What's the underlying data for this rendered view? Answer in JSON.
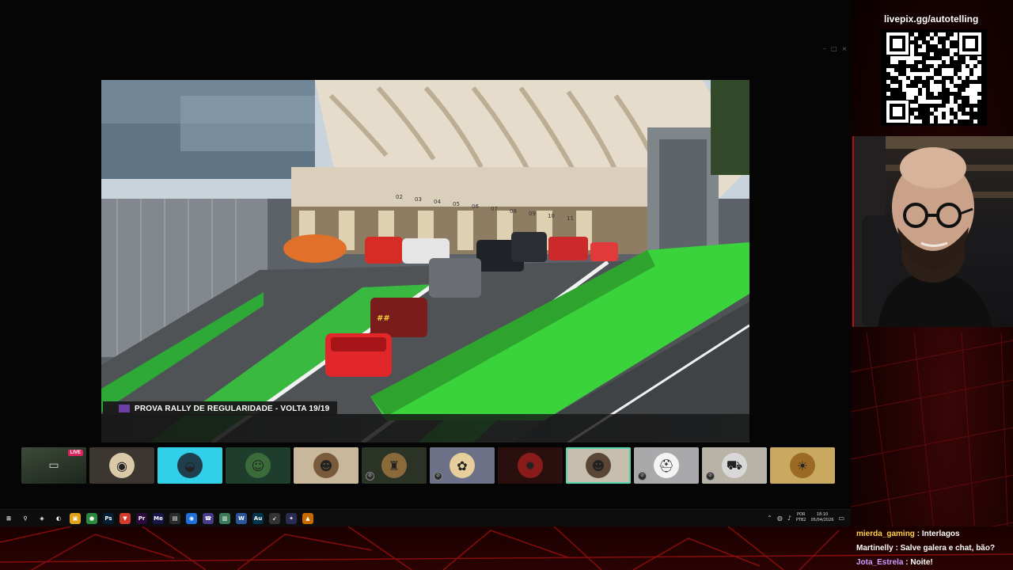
{
  "video": {
    "overlay_title": "PROVA RALLY DE REGULARIDADE  -  VOLTA 19/19",
    "pit_numbers": [
      "02",
      "03",
      "04",
      "05",
      "06",
      "07",
      "08",
      "09",
      "10",
      "11"
    ],
    "car_plate": "##"
  },
  "participants": [
    {
      "kind": "live",
      "badge": "LIVE",
      "bg": "#2a3a2a",
      "muted": false
    },
    {
      "kind": "avatar",
      "glyph": "◉",
      "bg": "#3b3631",
      "avatar": "#d9c9a8",
      "muted": false
    },
    {
      "kind": "avatar",
      "glyph": "◒",
      "bg": "#2fd0e8",
      "avatar": "#1d3e4a",
      "muted": false
    },
    {
      "kind": "avatar",
      "glyph": "☺",
      "bg": "#1e3d2c",
      "avatar": "#3a6b3a",
      "muted": false
    },
    {
      "kind": "avatar",
      "glyph": "☻",
      "bg": "#c9b79c",
      "avatar": "#7a5a3a",
      "muted": false
    },
    {
      "kind": "avatar",
      "glyph": "♜",
      "bg": "#2b3326",
      "avatar": "#8a6a3a",
      "muted": true
    },
    {
      "kind": "avatar",
      "glyph": "✿",
      "bg": "#6c7187",
      "avatar": "#e6cf9c",
      "muted": true
    },
    {
      "kind": "avatar",
      "glyph": "✹",
      "bg": "#2a0f0f",
      "avatar": "#8a1b1b",
      "muted": false
    },
    {
      "kind": "avatar",
      "glyph": "☻",
      "bg": "#c7bfae",
      "avatar": "#5a4536",
      "muted": false,
      "active": true
    },
    {
      "kind": "avatar",
      "glyph": "⛑",
      "bg": "#a9a9ab",
      "avatar": "#f4f4f4",
      "muted": true
    },
    {
      "kind": "avatar",
      "glyph": "⛟",
      "bg": "#b8b3a6",
      "avatar": "#d8d8d8",
      "muted": true
    },
    {
      "kind": "avatar",
      "glyph": "☀",
      "bg": "#c9a860",
      "avatar": "#9b6b26",
      "muted": false
    }
  ],
  "taskbar": {
    "icons": [
      {
        "glyph": "⊞",
        "bg": "transparent"
      },
      {
        "glyph": "⚲",
        "bg": "transparent"
      },
      {
        "glyph": "◈",
        "bg": "transparent"
      },
      {
        "glyph": "◐",
        "bg": "transparent"
      },
      {
        "glyph": "▣",
        "bg": "#e0a21a"
      },
      {
        "glyph": "●",
        "bg": "#2b8a3e"
      },
      {
        "glyph": "Ps",
        "bg": "#001e36"
      },
      {
        "glyph": "▼",
        "bg": "#d13b2e"
      },
      {
        "glyph": "Pr",
        "bg": "#2a0a3d"
      },
      {
        "glyph": "Me",
        "bg": "#18154a"
      },
      {
        "glyph": "▤",
        "bg": "#2b2b2b"
      },
      {
        "glyph": "◉",
        "bg": "#1e6fd9"
      },
      {
        "glyph": "☎",
        "bg": "#4a3a8a"
      },
      {
        "glyph": "▥",
        "bg": "#3a7a5a"
      },
      {
        "glyph": "W",
        "bg": "#2b579a"
      },
      {
        "glyph": "Au",
        "bg": "#00344a"
      },
      {
        "glyph": "➹",
        "bg": "#333333"
      },
      {
        "glyph": "✦",
        "bg": "#2a2a55"
      },
      {
        "glyph": "▲",
        "bg": "#c96a00"
      }
    ],
    "tray": {
      "lang_top": "POR",
      "lang_bottom": "PTB2",
      "time": "18:10",
      "date": "05/04/2026"
    }
  },
  "side": {
    "donate_url": "livepix.gg/autotelling"
  },
  "chat": [
    {
      "user": "mierda_gaming",
      "color": "#ffd24a",
      "text": "Interlagos"
    },
    {
      "user": "Martinelly",
      "color": "#ffffff",
      "text": "Salve galera e chat, bão?"
    },
    {
      "user": "Jota_Estrela",
      "color": "#c9a0ff",
      "text": "Noite!"
    }
  ]
}
